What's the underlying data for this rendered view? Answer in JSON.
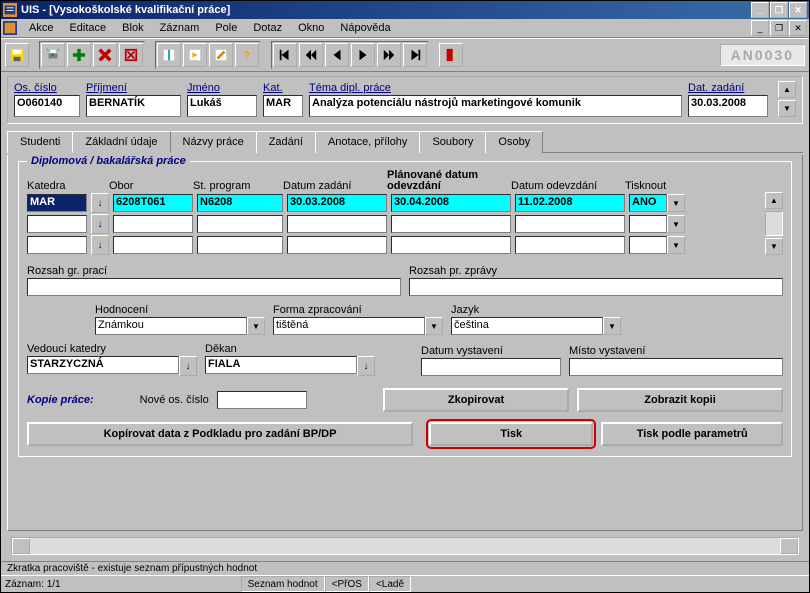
{
  "window": {
    "title": "UIS - [Vysokoškolské kvalifikační práce]"
  },
  "menu": [
    "Akce",
    "Editace",
    "Blok",
    "Záznam",
    "Pole",
    "Dotaz",
    "Okno",
    "Nápověda"
  ],
  "user_code": "AN0030",
  "header": {
    "os_cislo": {
      "label": "Os. číslo",
      "value": "O060140"
    },
    "prijmeni": {
      "label": "Příjmení",
      "value": "BERNATÍK"
    },
    "jmeno": {
      "label": "Jméno",
      "value": "Lukáš"
    },
    "kat": {
      "label": "Kat.",
      "value": "MAR"
    },
    "tema": {
      "label": "Téma dipl. práce",
      "value": "Analýza potenciálu nástrojů marketingové komunik"
    },
    "dat_zadani": {
      "label": "Dat. zadání",
      "value": "30.03.2008"
    }
  },
  "tabs": [
    "Studenti",
    "Základní údaje",
    "Názvy práce",
    "Zadání",
    "Anotace, přílohy",
    "Soubory",
    "Osoby"
  ],
  "active_tab": 1,
  "group": {
    "title": "Diplomová / bakalářská práce",
    "grid": {
      "columns": [
        "Katedra",
        "Obor",
        "St. program",
        "Datum zadání",
        "Plánované datum odevzdání",
        "Datum odevzdání",
        "Tisknout"
      ],
      "rows": [
        {
          "katedra": "MAR",
          "obor": "6208T061",
          "program": "N6208",
          "dat_zadani": "30.03.2008",
          "plan_odevzdani": "30.04.2008",
          "dat_odevzdani": "11.02.2008",
          "tisknout": "ANO",
          "hl": true
        },
        {
          "katedra": "",
          "obor": "",
          "program": "",
          "dat_zadani": "",
          "plan_odevzdani": "",
          "dat_odevzdani": "",
          "tisknout": "",
          "hl": false
        },
        {
          "katedra": "",
          "obor": "",
          "program": "",
          "dat_zadani": "",
          "plan_odevzdani": "",
          "dat_odevzdani": "",
          "tisknout": "",
          "hl": false
        }
      ]
    },
    "rozsah_gr": {
      "label": "Rozsah gr. prací",
      "value": ""
    },
    "rozsah_pr": {
      "label": "Rozsah pr. zprávy",
      "value": ""
    },
    "hodnoceni": {
      "label": "Hodnocení",
      "value": "Známkou"
    },
    "forma": {
      "label": "Forma zpracování",
      "value": "tištěná"
    },
    "jazyk": {
      "label": "Jazyk",
      "value": "čeština"
    },
    "vedouci": {
      "label": "Vedoucí katedry",
      "value": "STARZYCZNÁ"
    },
    "dekan": {
      "label": "Děkan",
      "value": "FIALA"
    },
    "dat_vyst": {
      "label": "Datum vystavení",
      "value": ""
    },
    "misto_vyst": {
      "label": "Místo vystavení",
      "value": ""
    },
    "kopie_label": "Kopie práce:",
    "nove_os": {
      "label": "Nové os. číslo",
      "value": ""
    },
    "btn_zkopirovat": "Zkopirovat",
    "btn_zobrazit": "Zobrazit kopii",
    "btn_kopirovat_podklad": "Kopírovat data z Podkladu pro zadání BP/DP",
    "btn_tisk": "Tisk",
    "btn_tisk_param": "Tisk podle parametrů"
  },
  "status": {
    "hint": "Zkratka pracoviště - existuje seznam přípustných hodnot",
    "zaznam_label": "Záznam:",
    "zaznam": "1/1",
    "segments": [
      "Seznam hodnot",
      "<PřOS",
      "<Ladě"
    ]
  }
}
